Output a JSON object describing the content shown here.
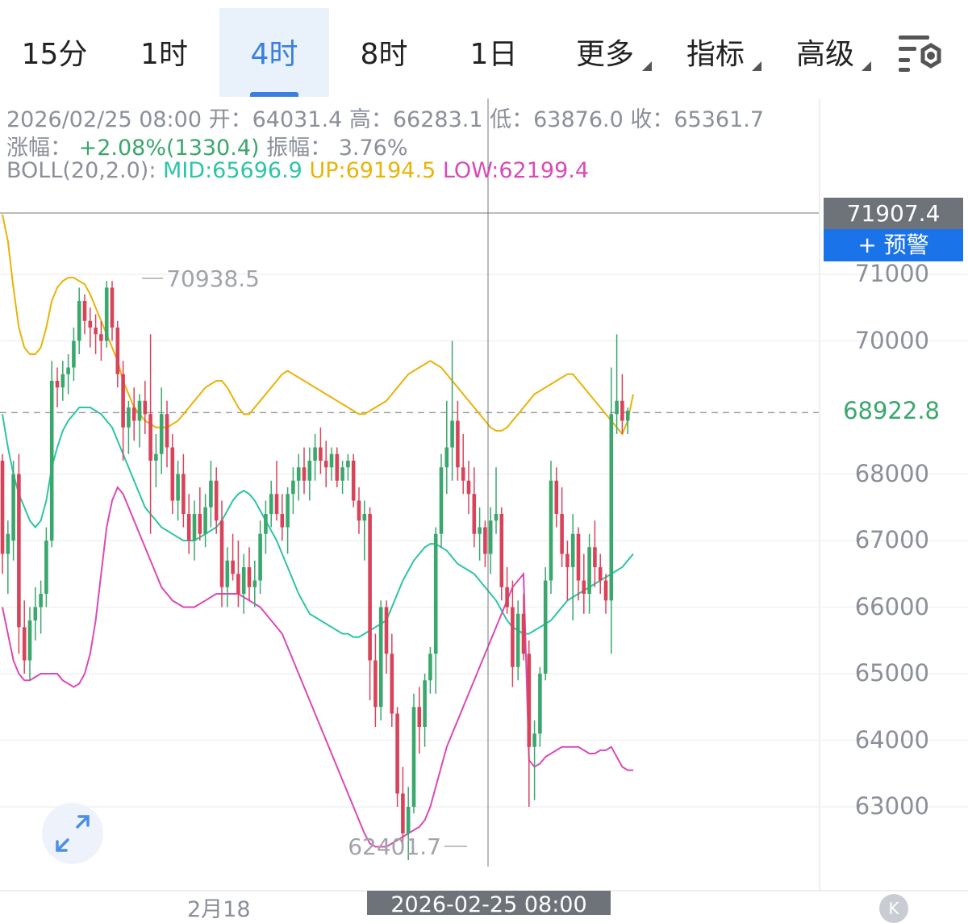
{
  "tabs": [
    {
      "label": "15分",
      "active": false
    },
    {
      "label": "1时",
      "active": false
    },
    {
      "label": "4时",
      "active": true
    },
    {
      "label": "8时",
      "active": false
    },
    {
      "label": "1日",
      "active": false
    },
    {
      "label": "更多",
      "active": false,
      "dropdown": true
    },
    {
      "label": "指标",
      "active": false,
      "dropdown": true
    },
    {
      "label": "高级",
      "active": false,
      "dropdown": true
    }
  ],
  "settings_icon": "chart-settings-icon",
  "info": {
    "datetime": "2026/02/25 08:00",
    "open_label": "开：",
    "open": "64031.4",
    "high_label": "高：",
    "high": "66283.1",
    "low_label": "低：",
    "low": "63876.0",
    "close_label": "收：",
    "close": "65361.7",
    "change_label": "涨幅：",
    "change": "+2.08%(1330.4)",
    "amplitude_label": "振幅：",
    "amplitude": "3.76%",
    "boll_label": "BOLL(20,2.0):",
    "boll_mid": "MID:65696.9",
    "boll_up": "UP:69194.5",
    "boll_low": "LOW:62199.4"
  },
  "price_tag_top": "71907.4",
  "alert_button": "+ 预警",
  "last_price": "68922.8",
  "high_marker": "70938.5",
  "low_marker": "62401.7",
  "colors": {
    "up": "#3aa76d",
    "down": "#d9435a",
    "mid": "#2ec4a6",
    "upper": "#e8b30a",
    "lower": "#d94ab7",
    "accent": "#3a7fe0"
  },
  "chart_data": {
    "type": "candlestick",
    "interval": "4时",
    "ylim": [
      62000,
      72100
    ],
    "y_ticks": [
      71000,
      70000,
      68000,
      67000,
      66000,
      65000,
      64000,
      63000
    ],
    "x_labels": [
      "2月18"
    ],
    "crosshair": {
      "x_label": "2026-02-25 08:00",
      "price": "71907.4"
    },
    "last_price": 68922.8,
    "annotations": [
      {
        "text": "70938.5",
        "type": "high"
      },
      {
        "text": "62401.7",
        "type": "low"
      }
    ],
    "candles": [
      [
        68200,
        68300,
        66500,
        66800
      ],
      [
        66800,
        67300,
        66200,
        67100
      ],
      [
        67000,
        68200,
        66700,
        68000
      ],
      [
        68000,
        68300,
        65300,
        65700
      ],
      [
        65700,
        66100,
        65000,
        65200
      ],
      [
        65200,
        66000,
        64900,
        65800
      ],
      [
        65800,
        66300,
        65500,
        66000
      ],
      [
        66000,
        66400,
        65600,
        66200
      ],
      [
        66200,
        67200,
        66000,
        67000
      ],
      [
        67000,
        69700,
        66900,
        69400
      ],
      [
        69400,
        69600,
        69000,
        69300
      ],
      [
        69300,
        69700,
        69100,
        69500
      ],
      [
        69500,
        69800,
        69200,
        69600
      ],
      [
        69600,
        70200,
        69400,
        70000
      ],
      [
        70000,
        70800,
        69800,
        70600
      ],
      [
        70600,
        70700,
        70100,
        70300
      ],
      [
        70300,
        70500,
        69900,
        70200
      ],
      [
        70200,
        70400,
        69800,
        70100
      ],
      [
        70100,
        70300,
        69700,
        70000
      ],
      [
        70000,
        70900,
        69900,
        70800
      ],
      [
        70800,
        70900,
        70000,
        70200
      ],
      [
        70200,
        70300,
        69300,
        69500
      ],
      [
        69500,
        69700,
        68200,
        68700
      ],
      [
        68700,
        69100,
        68300,
        69000
      ],
      [
        69000,
        69300,
        68500,
        68800
      ],
      [
        68800,
        69200,
        68400,
        69100
      ],
      [
        69100,
        69400,
        68600,
        68900
      ],
      [
        68900,
        70100,
        67100,
        68200
      ],
      [
        68200,
        68600,
        67800,
        68300
      ],
      [
        68300,
        69300,
        68000,
        68900
      ],
      [
        68900,
        69100,
        68100,
        68400
      ],
      [
        68400,
        68600,
        67400,
        67600
      ],
      [
        67600,
        68200,
        67300,
        68000
      ],
      [
        68000,
        68300,
        67200,
        67400
      ],
      [
        67400,
        67700,
        66800,
        67000
      ],
      [
        67000,
        67600,
        66700,
        67400
      ],
      [
        67400,
        67800,
        67000,
        67100
      ],
      [
        67100,
        67700,
        66900,
        67500
      ],
      [
        67500,
        68200,
        67200,
        67900
      ],
      [
        67900,
        68100,
        67100,
        67300
      ],
      [
        67300,
        67600,
        66000,
        66300
      ],
      [
        66300,
        66900,
        66000,
        66700
      ],
      [
        66700,
        67100,
        66400,
        66500
      ],
      [
        66500,
        67000,
        66000,
        66200
      ],
      [
        66200,
        66800,
        65900,
        66600
      ],
      [
        66600,
        66900,
        66100,
        66300
      ],
      [
        66300,
        66700,
        66000,
        66400
      ],
      [
        66400,
        67300,
        66200,
        67100
      ],
      [
        67100,
        67600,
        66800,
        67400
      ],
      [
        67400,
        67900,
        67200,
        67700
      ],
      [
        67700,
        68200,
        67300,
        67400
      ],
      [
        67400,
        67700,
        67000,
        67200
      ],
      [
        67200,
        67800,
        66800,
        67700
      ],
      [
        67700,
        68100,
        67400,
        67900
      ],
      [
        67900,
        68300,
        67600,
        68100
      ],
      [
        68100,
        68400,
        67700,
        67900
      ],
      [
        67900,
        68400,
        67600,
        68200
      ],
      [
        68200,
        68600,
        67900,
        68400
      ],
      [
        68400,
        68700,
        68000,
        68200
      ],
      [
        68200,
        68500,
        67800,
        68100
      ],
      [
        68100,
        68400,
        67900,
        68300
      ],
      [
        68300,
        68400,
        67800,
        67900
      ],
      [
        67900,
        68200,
        67700,
        68100
      ],
      [
        68100,
        68300,
        67900,
        68200
      ],
      [
        68200,
        68300,
        67500,
        67600
      ],
      [
        67600,
        67800,
        67100,
        67300
      ],
      [
        67300,
        67600,
        66700,
        67400
      ],
      [
        67400,
        67500,
        64600,
        65200
      ],
      [
        65200,
        65600,
        64200,
        64500
      ],
      [
        64500,
        66100,
        64300,
        66000
      ],
      [
        66000,
        66100,
        65000,
        65300
      ],
      [
        65300,
        65600,
        64200,
        64400
      ],
      [
        64400,
        64500,
        63000,
        63200
      ],
      [
        63200,
        63600,
        62400,
        62600
      ],
      [
        62600,
        63300,
        62200,
        63000
      ],
      [
        63000,
        64700,
        62900,
        64500
      ],
      [
        64500,
        64800,
        63800,
        64200
      ],
      [
        64200,
        65000,
        63900,
        64900
      ],
      [
        64900,
        65400,
        64700,
        65300
      ],
      [
        65300,
        67200,
        64700,
        67100
      ],
      [
        67100,
        68300,
        66900,
        68100
      ],
      [
        68100,
        69100,
        67700,
        68400
      ],
      [
        68400,
        70000,
        67900,
        68800
      ],
      [
        68800,
        69100,
        67900,
        68100
      ],
      [
        68100,
        68600,
        67700,
        67900
      ],
      [
        67900,
        68200,
        67400,
        67700
      ],
      [
        67700,
        68100,
        66900,
        67100
      ],
      [
        67100,
        67500,
        66700,
        67200
      ],
      [
        67200,
        67300,
        66600,
        66800
      ],
      [
        66800,
        67500,
        66500,
        67300
      ],
      [
        67300,
        68100,
        67100,
        67400
      ],
      [
        67400,
        67500,
        66100,
        66300
      ],
      [
        66300,
        66600,
        65900,
        66000
      ],
      [
        66000,
        66400,
        64800,
        65100
      ],
      [
        65100,
        66100,
        64900,
        65900
      ],
      [
        65900,
        66200,
        65200,
        65300
      ],
      [
        65300,
        65500,
        63000,
        63900
      ],
      [
        63900,
        64300,
        63100,
        64100
      ],
      [
        64100,
        65100,
        63900,
        65000
      ],
      [
        65000,
        66600,
        64900,
        66400
      ],
      [
        66400,
        68200,
        66200,
        67900
      ],
      [
        67900,
        68100,
        67200,
        67400
      ],
      [
        67400,
        67800,
        66600,
        66800
      ],
      [
        66800,
        67000,
        66100,
        66600
      ],
      [
        66600,
        67400,
        65800,
        67100
      ],
      [
        67100,
        67200,
        66100,
        66400
      ],
      [
        66400,
        66800,
        65900,
        66200
      ],
      [
        66200,
        67100,
        65900,
        66900
      ],
      [
        66900,
        67300,
        66300,
        66600
      ],
      [
        66600,
        66800,
        66200,
        66400
      ],
      [
        66400,
        66500,
        65900,
        66100
      ],
      [
        66100,
        69600,
        65300,
        68900
      ],
      [
        68900,
        70100,
        68600,
        69100
      ],
      [
        69100,
        69500,
        68600,
        68800
      ],
      [
        68800,
        69000,
        68600,
        68950
      ]
    ],
    "series": [
      {
        "name": "MID",
        "values": [
          68900,
          68400,
          68000,
          67700,
          67500,
          67300,
          67200,
          67300,
          67600,
          68100,
          68400,
          68650,
          68800,
          68900,
          69000,
          69000,
          69000,
          68950,
          68900,
          68800,
          68700,
          68500,
          68300,
          68100,
          67900,
          67700,
          67500,
          67400,
          67300,
          67200,
          67150,
          67100,
          67050,
          67000,
          67000,
          67000,
          67050,
          67100,
          67150,
          67200,
          67300,
          67450,
          67600,
          67700,
          67750,
          67700,
          67600,
          67450,
          67300,
          67150,
          67000,
          66800,
          66600,
          66400,
          66200,
          66050,
          65900,
          65850,
          65800,
          65750,
          65700,
          65650,
          65600,
          65600,
          65550,
          65550,
          65600,
          65650,
          65700,
          65750,
          65800,
          66000,
          66200,
          66400,
          66550,
          66700,
          66800,
          66900,
          66950,
          66950,
          66900,
          66850,
          66750,
          66650,
          66600,
          66550,
          66500,
          66400,
          66300,
          66200,
          66100,
          65950,
          65800,
          65700,
          65650,
          65600,
          65600,
          65650,
          65700,
          65750,
          65800,
          65900,
          66000,
          66100,
          66150,
          66200,
          66250,
          66300,
          66350,
          66400,
          66450,
          66500,
          66550,
          66600,
          66700,
          66800
        ]
      },
      {
        "name": "UP",
        "values": [
          71900,
          71500,
          70800,
          70200,
          69900,
          69800,
          69800,
          69900,
          70200,
          70600,
          70800,
          70900,
          70950,
          70950,
          70900,
          70850,
          70700,
          70500,
          70300,
          70100,
          69900,
          69700,
          69400,
          69200,
          69000,
          68900,
          68800,
          68750,
          68700,
          68700,
          68700,
          68750,
          68800,
          68900,
          69000,
          69100,
          69200,
          69300,
          69350,
          69400,
          69400,
          69300,
          69150,
          69000,
          68900,
          68900,
          69000,
          69100,
          69200,
          69300,
          69400,
          69500,
          69550,
          69500,
          69450,
          69400,
          69350,
          69300,
          69250,
          69200,
          69150,
          69100,
          69050,
          69000,
          68950,
          68900,
          68900,
          68950,
          69000,
          69050,
          69100,
          69200,
          69300,
          69400,
          69500,
          69550,
          69600,
          69650,
          69700,
          69650,
          69600,
          69500,
          69400,
          69300,
          69200,
          69100,
          69000,
          68900,
          68800,
          68700,
          68650,
          68650,
          68700,
          68800,
          68900,
          69000,
          69100,
          69200,
          69250,
          69300,
          69350,
          69400,
          69450,
          69500,
          69500,
          69400,
          69300,
          69200,
          69100,
          69000,
          68900,
          68800,
          68700,
          68600,
          68800,
          69200
        ]
      },
      {
        "name": "LOW",
        "values": [
          66000,
          65600,
          65200,
          65000,
          64900,
          64900,
          64950,
          65000,
          65000,
          65000,
          65000,
          64900,
          64850,
          64800,
          64850,
          65000,
          65300,
          65800,
          66500,
          67200,
          67600,
          67800,
          67700,
          67500,
          67300,
          67100,
          66900,
          66700,
          66500,
          66300,
          66200,
          66100,
          66050,
          66000,
          66000,
          66000,
          66050,
          66100,
          66150,
          66200,
          66200,
          66200,
          66200,
          66200,
          66150,
          66100,
          66050,
          66000,
          65900,
          65800,
          65700,
          65600,
          65400,
          65200,
          65000,
          64800,
          64600,
          64400,
          64200,
          64000,
          63800,
          63600,
          63400,
          63200,
          63000,
          62800,
          62600,
          62450,
          62400,
          62400,
          62400,
          62450,
          62500,
          62550,
          62600,
          62650,
          62700,
          62800,
          63000,
          63300,
          63600,
          63900,
          64100,
          64300,
          64500,
          64700,
          64900,
          65100,
          65300,
          65500,
          65700,
          65900,
          66100,
          66300,
          66400,
          66500,
          63700,
          63600,
          63650,
          63750,
          63800,
          63850,
          63900,
          63900,
          63900,
          63900,
          63850,
          63800,
          63800,
          63850,
          63850,
          63900,
          63750,
          63600,
          63550,
          63550
        ]
      }
    ]
  }
}
